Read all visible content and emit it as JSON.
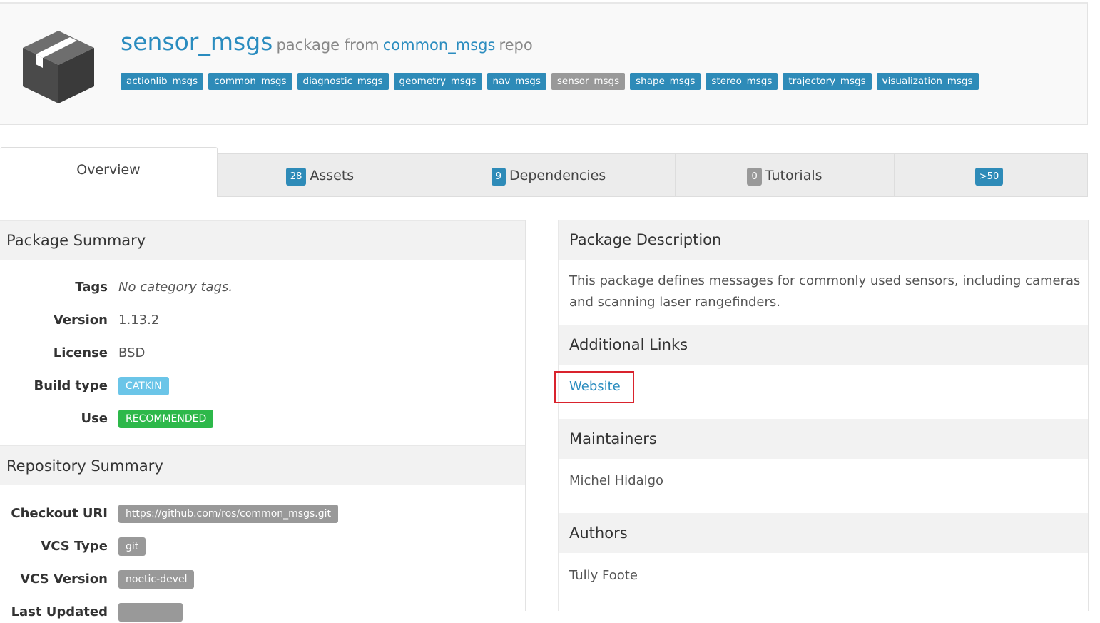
{
  "header": {
    "package_name": "sensor_msgs",
    "package_from": "package from",
    "repo_name": "common_msgs",
    "repo_suffix": "repo",
    "repo_packages": [
      {
        "label": "actionlib_msgs",
        "active": false
      },
      {
        "label": "common_msgs",
        "active": false
      },
      {
        "label": "diagnostic_msgs",
        "active": false
      },
      {
        "label": "geometry_msgs",
        "active": false
      },
      {
        "label": "nav_msgs",
        "active": false
      },
      {
        "label": "sensor_msgs",
        "active": true
      },
      {
        "label": "shape_msgs",
        "active": false
      },
      {
        "label": "stereo_msgs",
        "active": false
      },
      {
        "label": "trajectory_msgs",
        "active": false
      },
      {
        "label": "visualization_msgs",
        "active": false
      }
    ]
  },
  "tabs": [
    {
      "label": "Overview",
      "count": null
    },
    {
      "label": "Assets",
      "count": "28"
    },
    {
      "label": "Dependencies",
      "count": "9"
    },
    {
      "label": "Tutorials",
      "count": "0"
    },
    {
      "label": "",
      "count": ">50"
    }
  ],
  "package_summary": {
    "heading": "Package Summary",
    "tags_label": "Tags",
    "tags_value": "No category tags.",
    "version_label": "Version",
    "version_value": "1.13.2",
    "license_label": "License",
    "license_value": "BSD",
    "build_type_label": "Build type",
    "build_type_value": "CATKIN",
    "use_label": "Use",
    "use_value": "RECOMMENDED"
  },
  "repository_summary": {
    "heading": "Repository Summary",
    "checkout_label": "Checkout URI",
    "checkout_value": "https://github.com/ros/common_msgs.git",
    "vcs_type_label": "VCS Type",
    "vcs_type_value": "git",
    "vcs_version_label": "VCS Version",
    "vcs_version_value": "noetic-devel",
    "last_updated_label": "Last Updated"
  },
  "package_description": {
    "heading": "Package Description",
    "text_line1": "This package defines messages for commonly used sensors, including cameras",
    "text_line2": "and scanning laser rangefinders.",
    "links_heading": "Additional Links",
    "website_label": "Website",
    "maintainers_heading": "Maintainers",
    "maintainer": "Michel Hidalgo",
    "authors_heading": "Authors",
    "author": "Tully Foote"
  },
  "colors": {
    "link": "#2a8cbf",
    "tag_bg": "#2e8bb8",
    "highlight": "#d9232d",
    "success": "#2db84a",
    "info": "#6bc5e8"
  }
}
